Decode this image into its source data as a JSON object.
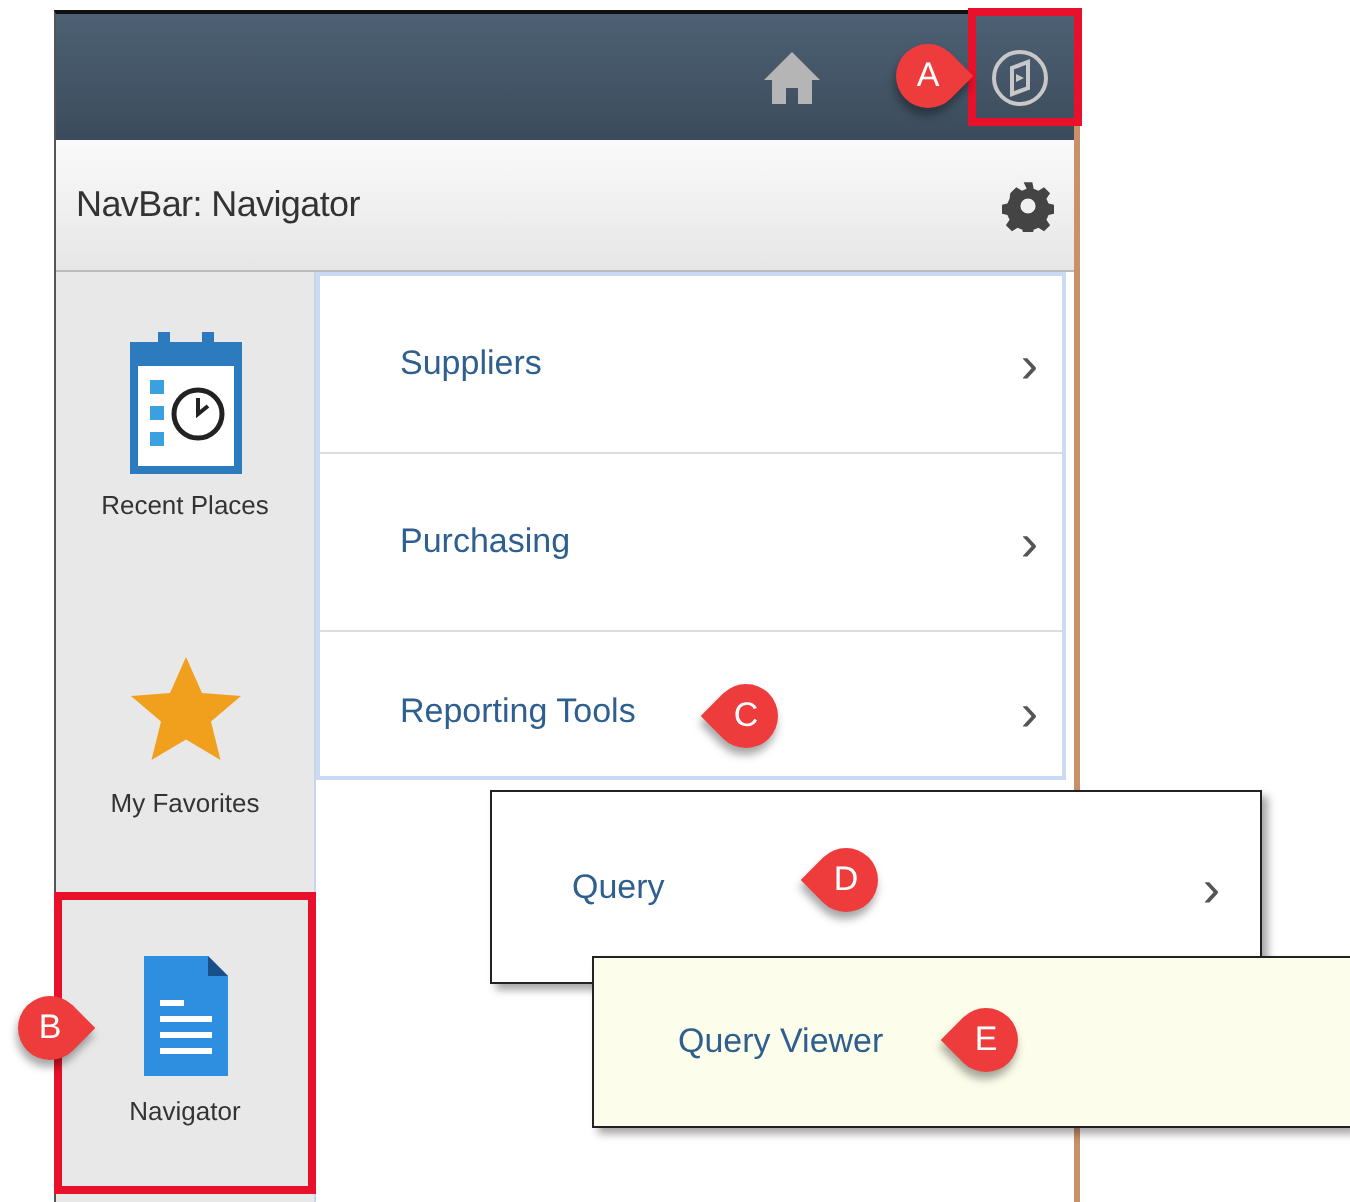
{
  "header": {
    "icons": [
      {
        "kind": "home"
      },
      {
        "kind": "compass"
      }
    ]
  },
  "title_bar": {
    "title": "NavBar: Navigator"
  },
  "sidebar": {
    "items": [
      {
        "label": "Recent Places",
        "kind": "calendar",
        "selected": false
      },
      {
        "label": "My Favorites",
        "kind": "star",
        "selected": false
      },
      {
        "label": "Navigator",
        "kind": "document",
        "selected": true
      }
    ]
  },
  "menu": {
    "items": [
      {
        "label": "Suppliers",
        "chevron": "›"
      },
      {
        "label": "Purchasing",
        "chevron": "›"
      },
      {
        "label": "Reporting Tools",
        "chevron": "›"
      }
    ]
  },
  "flyouts": [
    {
      "label": "Query",
      "chevron": "›",
      "kind": "folder"
    },
    {
      "label": "Query Viewer",
      "kind": "leaf"
    }
  ],
  "callouts": [
    {
      "label": "A"
    },
    {
      "label": "B"
    },
    {
      "label": "C"
    },
    {
      "label": "D"
    },
    {
      "label": "E"
    }
  ]
}
